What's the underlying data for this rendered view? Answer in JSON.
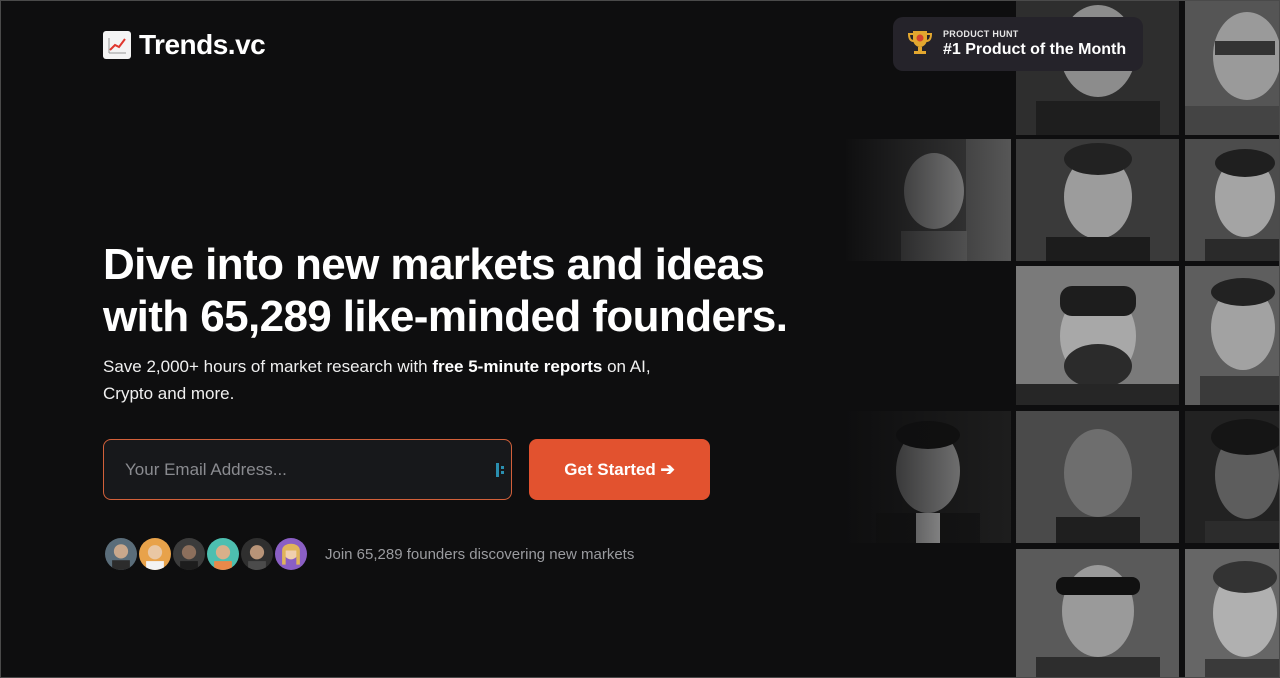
{
  "header": {
    "logo_icon": "chart-increasing-icon",
    "logo_text": "Trends.vc"
  },
  "badge": {
    "icon": "trophy-icon",
    "small_label": "PRODUCT HUNT",
    "title": "#1 Product of the Month"
  },
  "hero": {
    "headline_line1": "Dive into new markets and ideas",
    "headline_line2": "with 65,289 like-minded founders.",
    "sub_part1": "Save 2,000+ hours of market research with ",
    "sub_bold": "free 5-minute reports",
    "sub_part2": " on AI,",
    "sub_line2": "Crypto and more."
  },
  "signup": {
    "email_placeholder": "Your Email Address...",
    "cta_label": "Get Started ➔"
  },
  "social_proof": {
    "text": "Join 65,289 founders discovering new markets",
    "avatar_colors": [
      "#5a6d7a",
      "#e8a24a",
      "#3b3b3b",
      "#4dbfb0",
      "#2f2f2f",
      "#8a5fc4"
    ]
  },
  "colors": {
    "accent": "#e2522f",
    "background": "#0e0e0f",
    "badge_bg": "#25232a"
  }
}
